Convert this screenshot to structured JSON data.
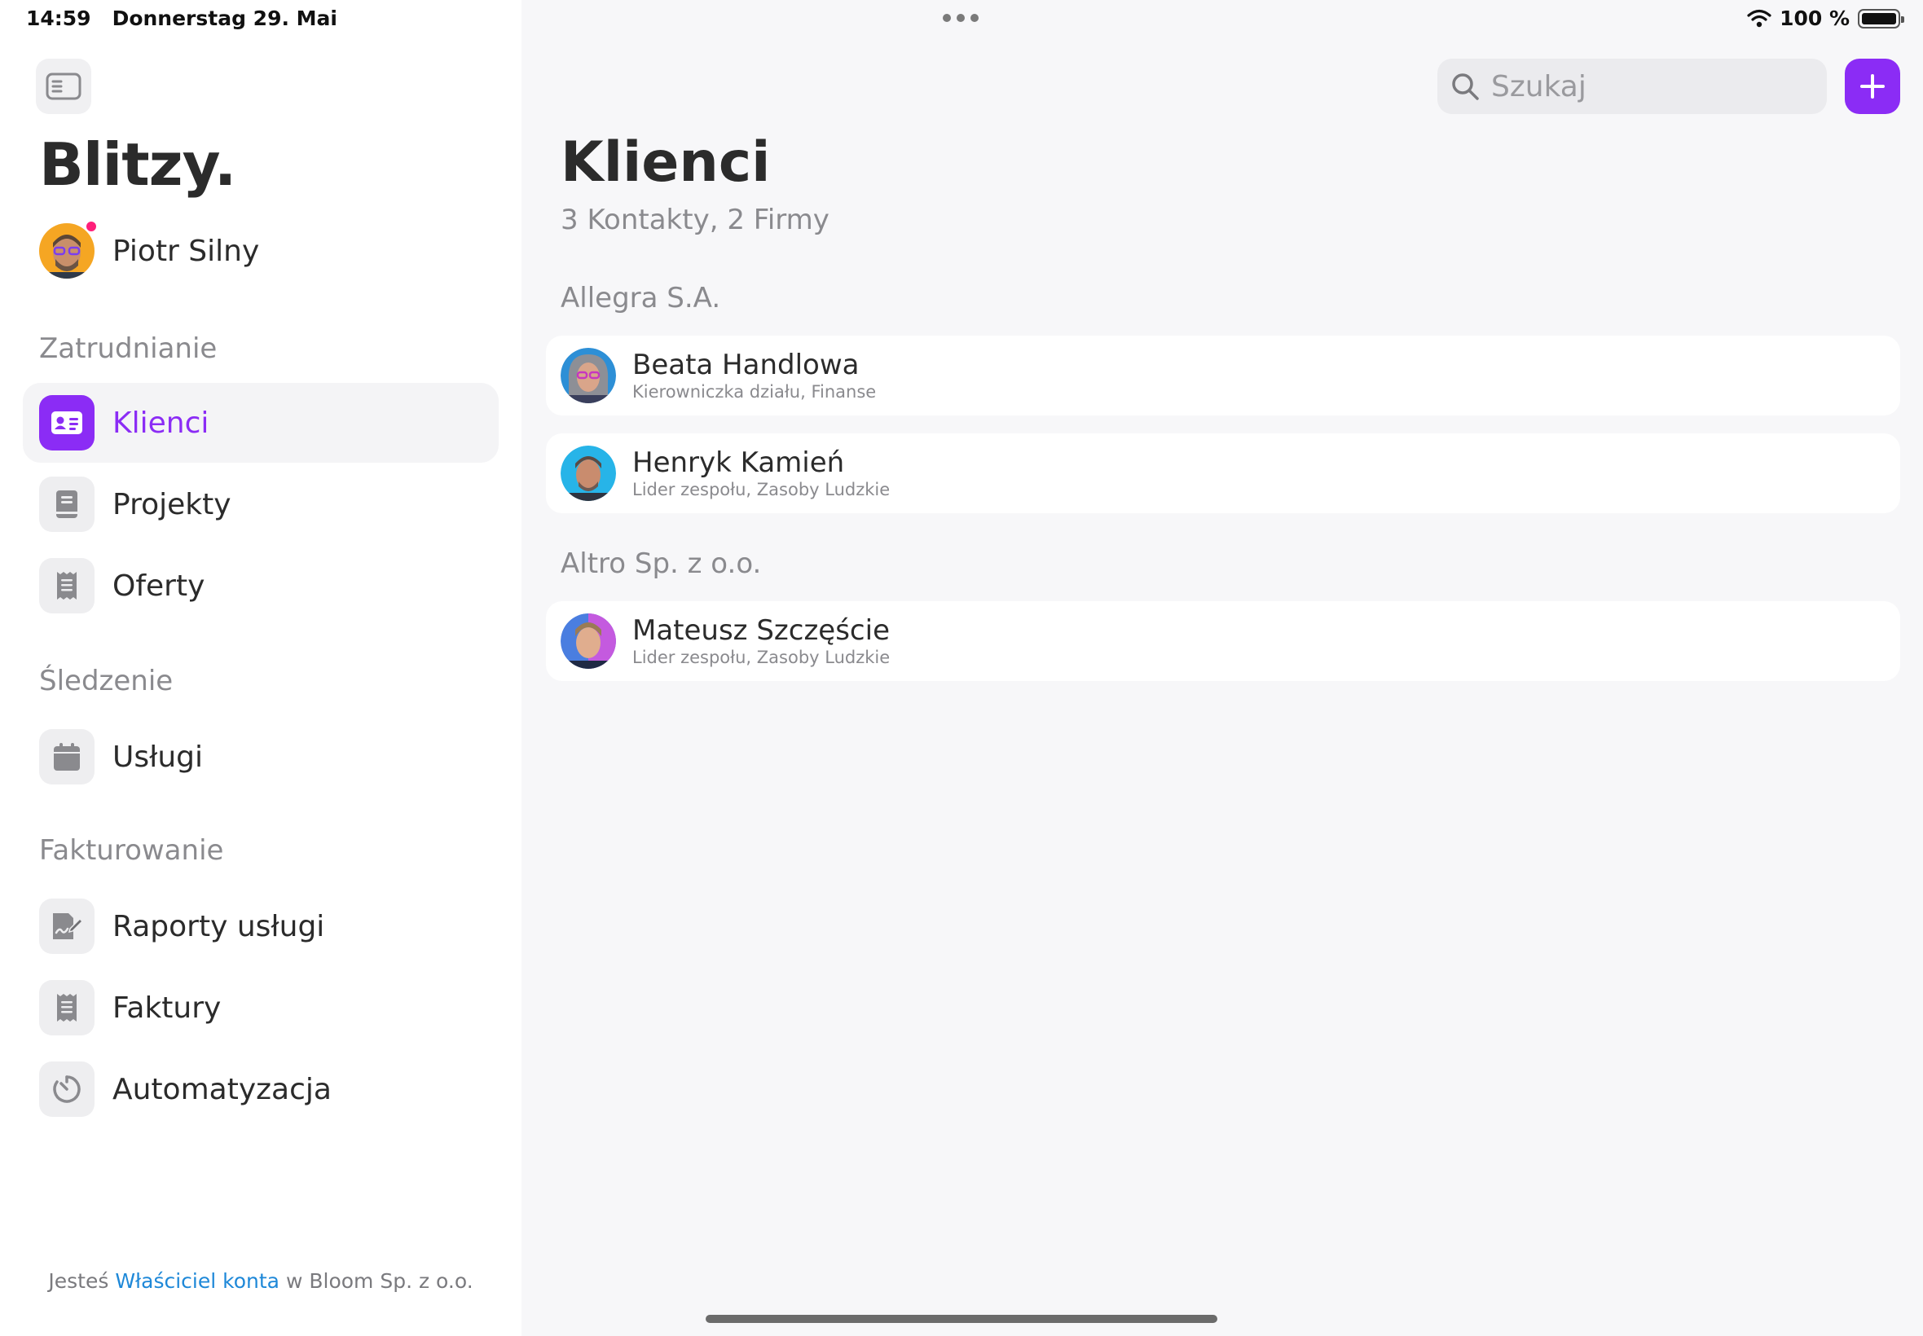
{
  "status_bar": {
    "time": "14:59",
    "date": "Donnerstag 29. Mai",
    "battery": "100 %"
  },
  "sidebar": {
    "brand": "Blitzy.",
    "user": {
      "name": "Piotr Silny"
    },
    "sections": [
      {
        "label": "Zatrudnianie",
        "items": [
          {
            "label": "Klienci",
            "icon": "contact-card-icon",
            "active": true
          },
          {
            "label": "Projekty",
            "icon": "book-icon",
            "active": false
          },
          {
            "label": "Oferty",
            "icon": "receipt-icon",
            "active": false
          }
        ]
      },
      {
        "label": "Śledzenie",
        "items": [
          {
            "label": "Usługi",
            "icon": "calendar-icon",
            "active": false
          }
        ]
      },
      {
        "label": "Fakturowanie",
        "items": [
          {
            "label": "Raporty usługi",
            "icon": "document-edit-icon",
            "active": false
          },
          {
            "label": "Faktury",
            "icon": "receipt-icon",
            "active": false
          },
          {
            "label": "Automatyzacja",
            "icon": "timer-icon",
            "active": false
          }
        ]
      }
    ],
    "footer": {
      "prefix": "Jesteś",
      "role_link": "Właściciel konta",
      "suffix": "w Bloom Sp. z o.o."
    }
  },
  "main": {
    "search_placeholder": "Szukaj",
    "title": "Klienci",
    "subtitle": "3 Kontakty, 2 Firmy",
    "groups": [
      {
        "company": "Allegra S.A.",
        "contacts": [
          {
            "name": "Beata Handlowa",
            "role": "Kierowniczka działu, Finanse"
          },
          {
            "name": "Henryk Kamień",
            "role": "Lider zespołu, Zasoby Ludzkie"
          }
        ]
      },
      {
        "company": "Altro Sp. z o.o.",
        "contacts": [
          {
            "name": "Mateusz Szczęście",
            "role": "Lider zespołu, Zasoby Ludzkie"
          }
        ]
      }
    ]
  },
  "colors": {
    "accent": "#8b2cf5",
    "link": "#1e88d8",
    "notification": "#ff1f7a"
  }
}
